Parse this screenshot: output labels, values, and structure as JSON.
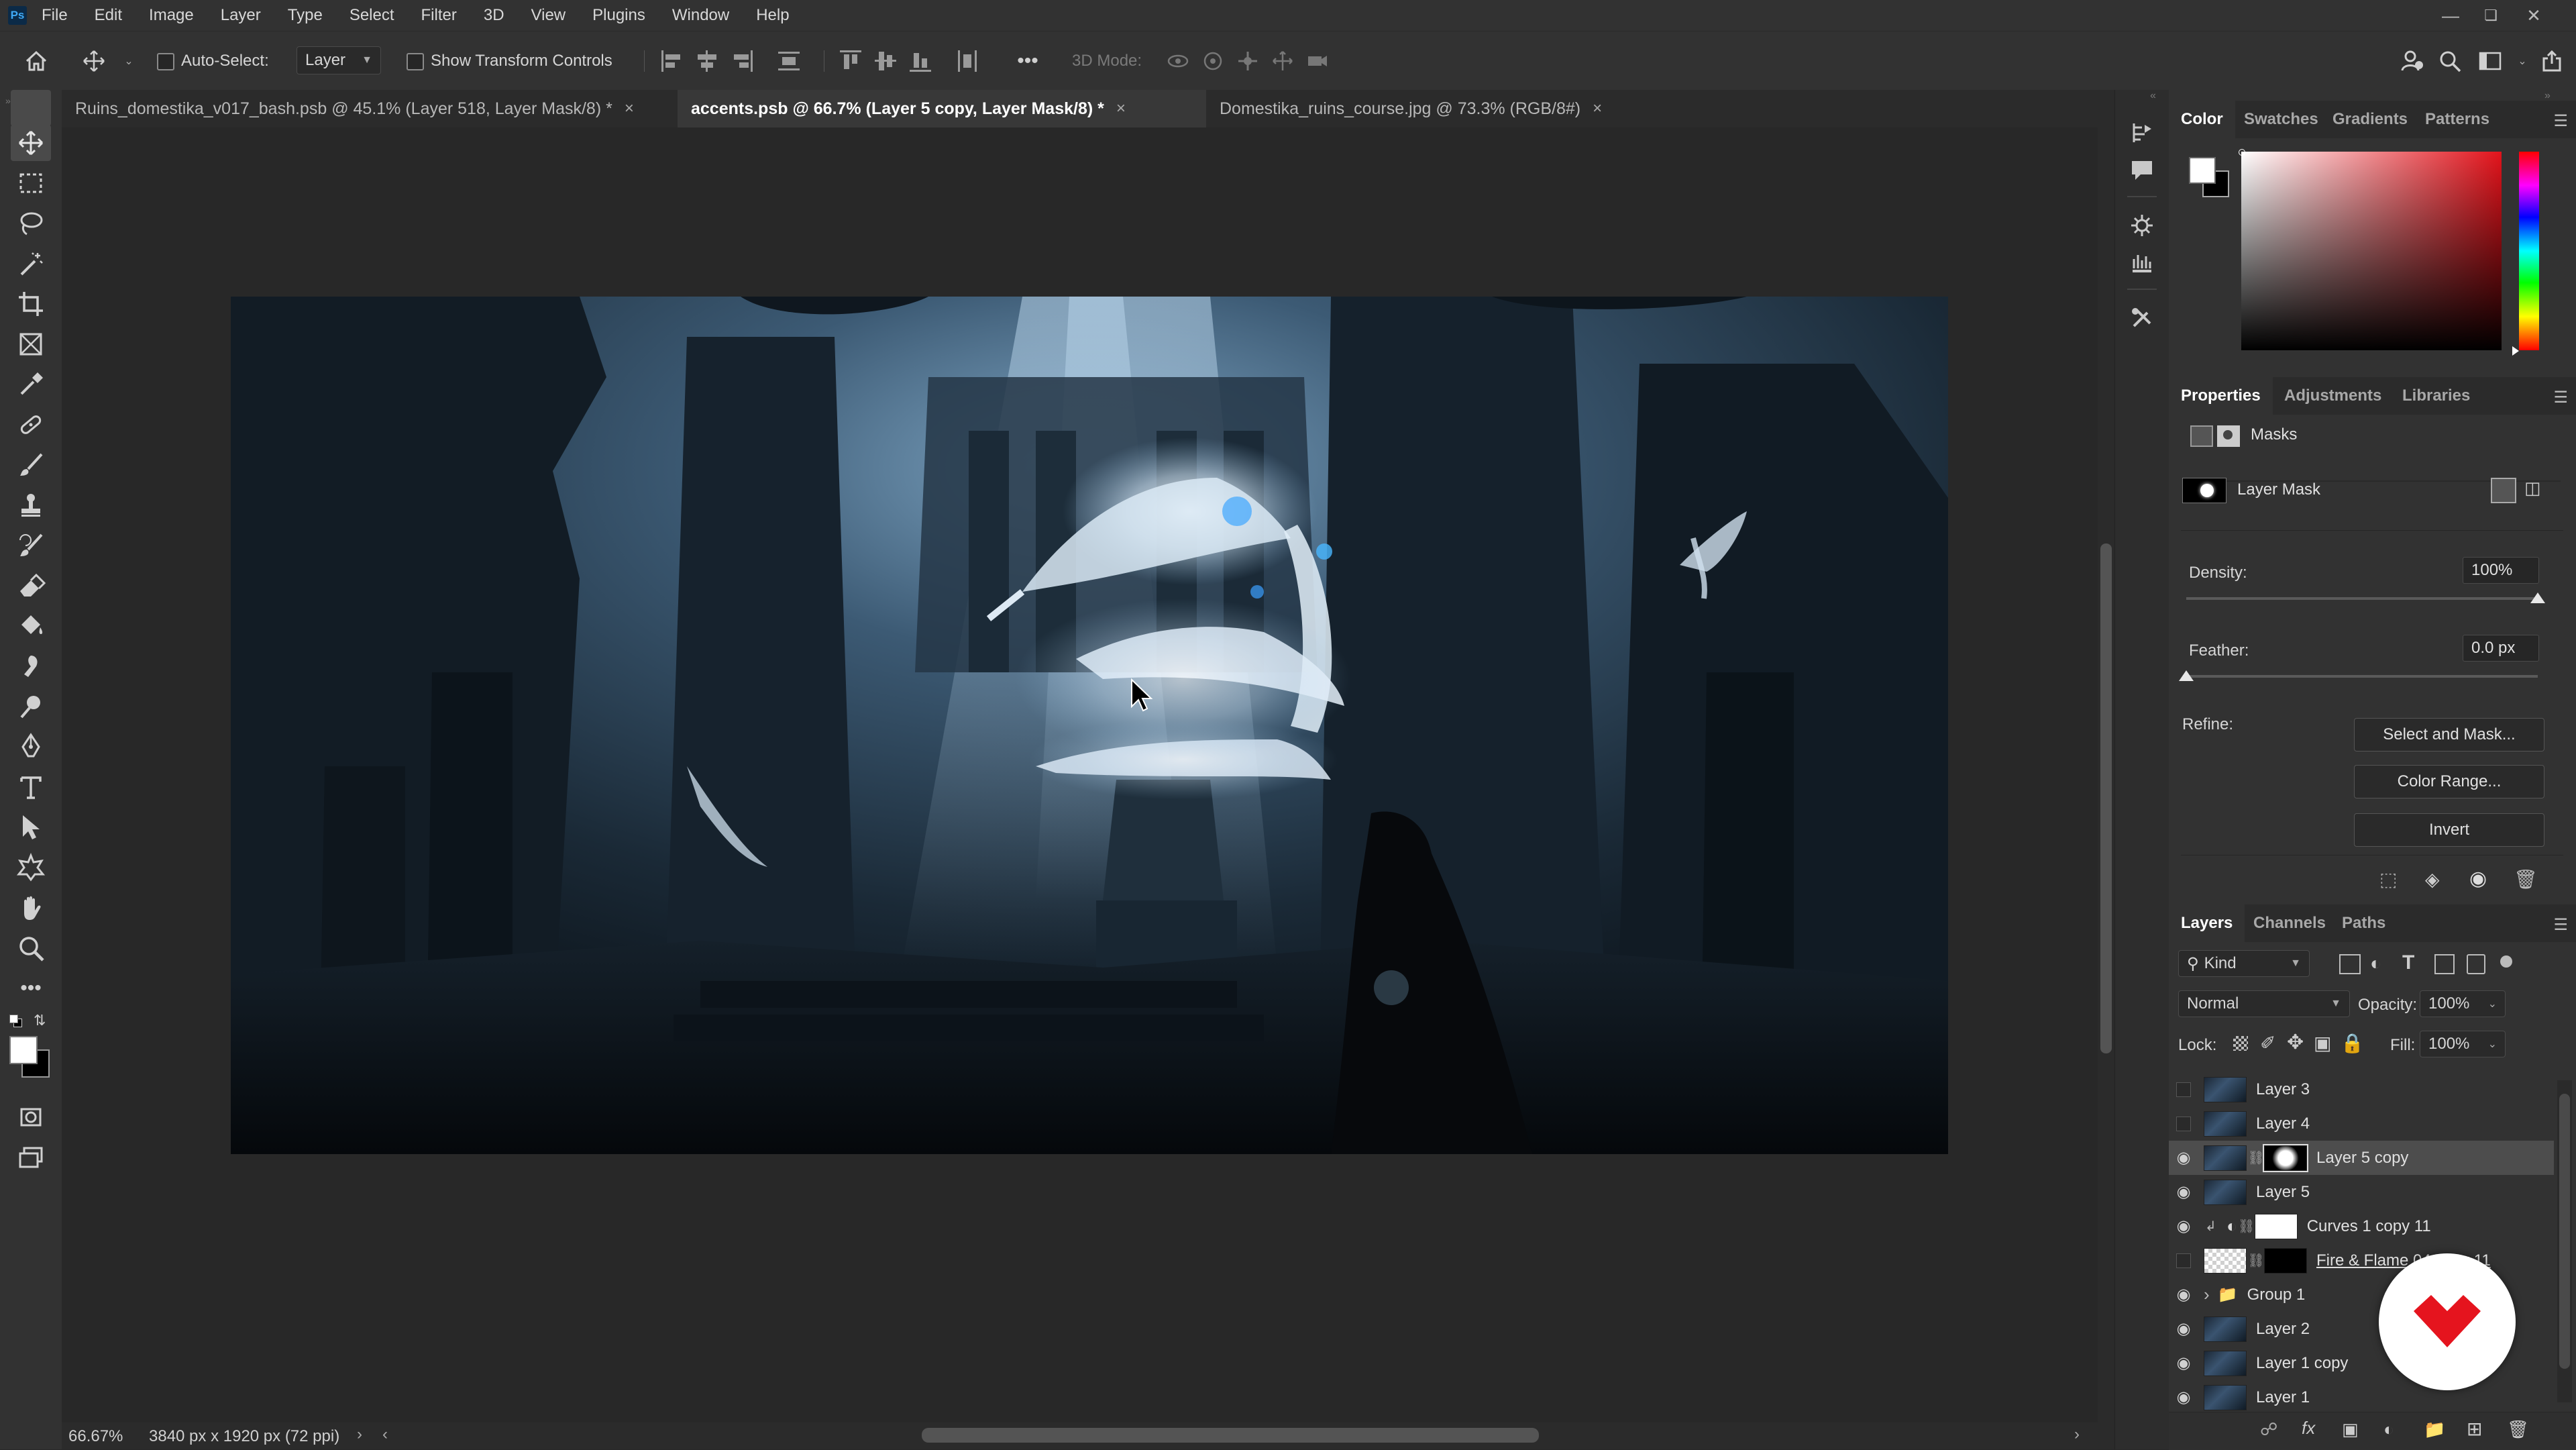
{
  "menubar": {
    "logo": "Ps",
    "items": [
      "File",
      "Edit",
      "Image",
      "Layer",
      "Type",
      "Select",
      "Filter",
      "3D",
      "View",
      "Plugins",
      "Window",
      "Help"
    ]
  },
  "options": {
    "auto_select_label": "Auto-Select:",
    "auto_select_value": "Layer",
    "show_transform_label": "Show Transform Controls",
    "mode_3d_label": "3D Mode:"
  },
  "tabs": [
    {
      "title": "Ruins_domestika_v017_bash.psb @ 45.1% (Layer 518, Layer Mask/8) *",
      "active": false
    },
    {
      "title": "accents.psb @ 66.7% (Layer 5 copy, Layer Mask/8) *",
      "active": true
    },
    {
      "title": "Domestika_ruins_course.jpg @ 73.3% (RGB/8#)",
      "active": false
    }
  ],
  "status": {
    "zoom": "66.67%",
    "doc_info": "3840 px x 1920 px (72 ppi)"
  },
  "color_panel": {
    "tabs": [
      "Color",
      "Swatches",
      "Gradients",
      "Patterns"
    ]
  },
  "properties_panel": {
    "tabs": [
      "Properties",
      "Adjustments",
      "Libraries"
    ],
    "section": "Masks",
    "mask_label": "Layer Mask",
    "density_label": "Density:",
    "density_value": "100%",
    "density_level": 1.0,
    "feather_label": "Feather:",
    "feather_value": "0.0 px",
    "feather_level": 0.0,
    "refine_label": "Refine:",
    "buttons": [
      "Select and Mask...",
      "Color Range...",
      "Invert"
    ]
  },
  "layers_panel": {
    "tabs": [
      "Layers",
      "Channels",
      "Paths"
    ],
    "filter_kind": "Kind",
    "blend_mode": "Normal",
    "opacity_label": "Opacity:",
    "opacity_value": "100%",
    "lock_label": "Lock:",
    "fill_label": "Fill:",
    "fill_value": "100%",
    "layers": [
      {
        "name": "Layer 3",
        "visible": false
      },
      {
        "name": "Layer 4",
        "visible": false
      },
      {
        "name": "Layer 5 copy",
        "visible": true,
        "selected": true,
        "mask": "white-blob"
      },
      {
        "name": "Layer 5",
        "visible": true
      },
      {
        "name": "Curves 1 copy 11",
        "visible": true,
        "adjustment": true,
        "mask": "white"
      },
      {
        "name": "Fire & Flame 04 copy 11",
        "visible": false,
        "mask": "black",
        "checker": true
      },
      {
        "name": "Group 1",
        "visible": true,
        "group": true
      },
      {
        "name": "Layer 2",
        "visible": true
      },
      {
        "name": "Layer 1 copy",
        "visible": true
      },
      {
        "name": "Layer 1",
        "visible": true
      }
    ]
  },
  "colors": {
    "foreground": "#ffffff",
    "background": "#000000",
    "accent_badge": "#e5141e"
  }
}
